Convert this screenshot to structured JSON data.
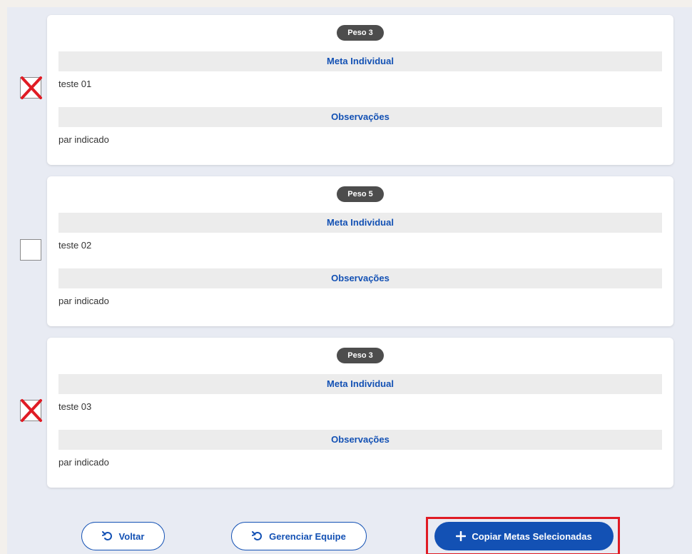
{
  "goals": [
    {
      "peso": "Peso 3",
      "meta_header": "Meta Individual",
      "meta_value": "teste 01",
      "obs_header": "Observações",
      "obs_value": "par indicado",
      "checked": true
    },
    {
      "peso": "Peso 5",
      "meta_header": "Meta Individual",
      "meta_value": "teste 02",
      "obs_header": "Observações",
      "obs_value": "par indicado",
      "checked": false
    },
    {
      "peso": "Peso 3",
      "meta_header": "Meta Individual",
      "meta_value": "teste 03",
      "obs_header": "Observações",
      "obs_value": "par indicado",
      "checked": true
    }
  ],
  "actions": {
    "back_label": "Voltar",
    "manage_label": "Gerenciar Equipe",
    "copy_label": "Copiar Metas Selecionadas"
  },
  "icons": {
    "back": "undo-icon",
    "manage": "undo-icon",
    "copy": "plus-icon",
    "check_mark": "red-x-mark-icon"
  },
  "colors": {
    "accent": "#1351b4",
    "highlight": "#e01b24",
    "badge": "#4d4d4d",
    "mark": "#e01b24"
  }
}
